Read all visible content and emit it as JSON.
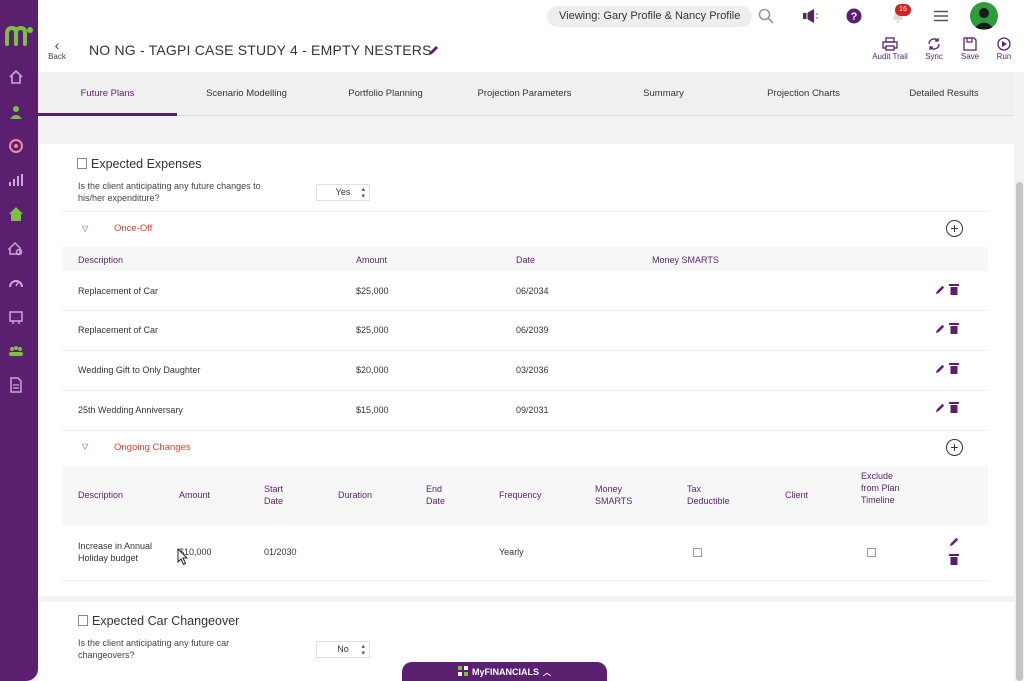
{
  "topbar": {
    "viewing": "Viewing: Gary Profile & Nancy Profile",
    "notification_count": "16"
  },
  "titlebar": {
    "back_label": "Back",
    "title": "NO NG - TAGPI CASE STUDY 4 - EMPTY NESTERS",
    "tools": [
      "Audit Trail",
      "Sync",
      "Save",
      "Run"
    ]
  },
  "tabs": [
    "Future Plans",
    "Scenario Modelling",
    "Portfolio Planning",
    "Projection Parameters",
    "Summary",
    "Projection Charts",
    "Detailed Results"
  ],
  "active_tab": "Future Plans",
  "expenses": {
    "title": "Expected Expenses",
    "question": "Is the client anticipating any future changes to his/her expenditure?",
    "answer": "Yes",
    "once_off": {
      "label": "Once-Off",
      "headers": [
        "Description",
        "Amount",
        "Date",
        "Money SMARTS"
      ],
      "rows": [
        {
          "description": "Replacement of Car",
          "amount": "$25,000",
          "date": "06/2034"
        },
        {
          "description": "Replacement of Car",
          "amount": "$25,000",
          "date": "06/2039"
        },
        {
          "description": "Wedding Gift to Only Daughter",
          "amount": "$20,000",
          "date": "03/2036"
        },
        {
          "description": "25th Wedding Anniversary",
          "amount": "$15,000",
          "date": "09/2031"
        }
      ]
    },
    "ongoing": {
      "label": "Ongoing Changes",
      "headers": {
        "description": "Description",
        "amount": "Amount",
        "start_date": "Start Date",
        "duration": "Duration",
        "end_date": "End Date",
        "frequency": "Frequency",
        "money_smarts": "Money SMARTS",
        "tax_deductible": "Tax Deductible",
        "client": "Client",
        "exclude": "Exclude from Plan Timeline"
      },
      "rows": [
        {
          "description": "Increase in Annual Holiday budget",
          "amount": "$10,000",
          "start_date": "01/2030",
          "frequency": "Yearly"
        }
      ]
    }
  },
  "car_changeover": {
    "title": "Expected Car Changeover",
    "question": "Is the client anticipating any future car changeovers?",
    "answer": "No"
  },
  "bottom_bar": {
    "label": "MyFINANCIALS"
  },
  "colors": {
    "brand": "#5a1f6e",
    "accent_red": "#d0453a",
    "avatar": "#2e9b3d"
  }
}
